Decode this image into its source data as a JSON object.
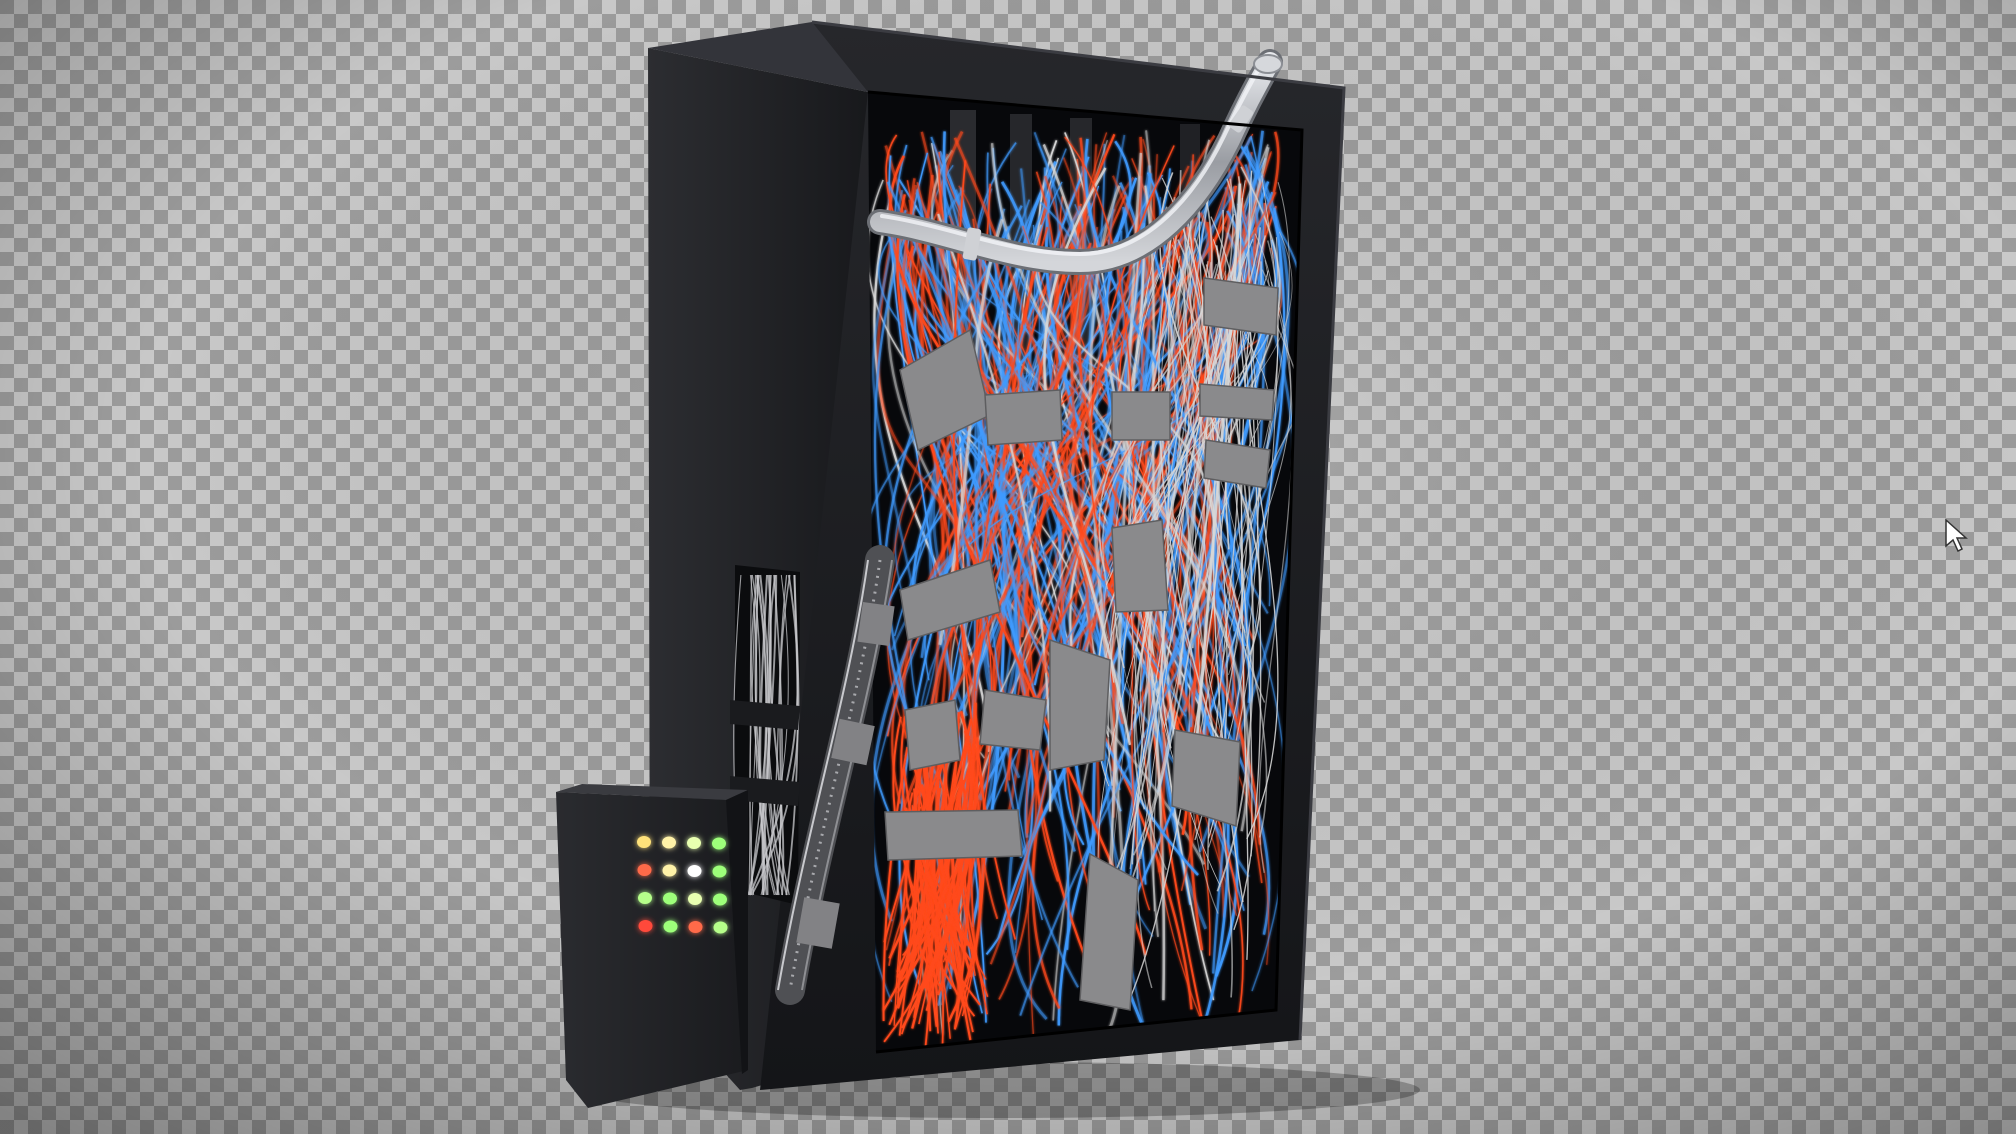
{
  "viewport": {
    "background": "transparency-checkerboard",
    "checker_light": "#c9c9c9",
    "checker_dark": "#9c9c9c"
  },
  "model": {
    "subject": "server-rack-cabinet-with-cables",
    "cabinet_color": "#1e1f22",
    "cable_colors": [
      "#3f9bff",
      "#ff4a1c",
      "#d8d8d8"
    ],
    "tape_color": "#8a8a8c",
    "conduit_color": "#b9bcc2"
  },
  "control_box": {
    "indicator_rows": [
      [
        "#ffe27a",
        "#fff2a8",
        "#e8ffb0",
        "#9dff7a"
      ],
      [
        "#ff6a4a",
        "#fff2a8",
        "#ffffff",
        "#9dff7a"
      ],
      [
        "#b6ff8a",
        "#9dff7a",
        "#e8ffb0",
        "#9dff7a"
      ],
      [
        "#ff4a3a",
        "#9dff7a",
        "#ff6a4a",
        "#b6ff8a"
      ]
    ]
  },
  "cursor": {
    "icon": "mouse-pointer-icon"
  }
}
